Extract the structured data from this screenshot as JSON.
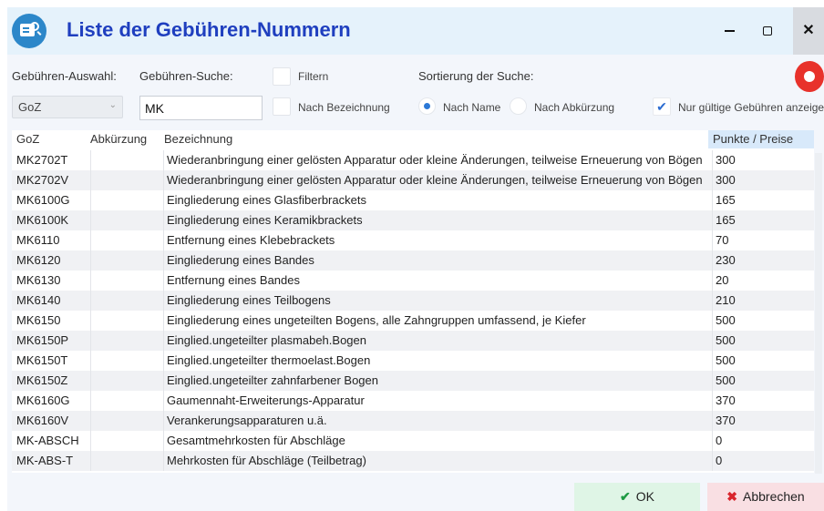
{
  "window": {
    "title": "Liste der Gebühren-Nummern"
  },
  "filters": {
    "selection_label": "Gebühren-Auswahl:",
    "selection_value": "GoZ",
    "search_label": "Gebühren-Suche:",
    "search_value": "MK",
    "filter_label": "Filtern",
    "by_description_label": "Nach Bezeichnung",
    "sort_label": "Sortierung der Suche:",
    "sort_by_name_label": "Nach Name",
    "sort_by_abbrev_label": "Nach Abkürzung",
    "only_valid_label": "Nur gültige Gebühren anzeigen"
  },
  "table": {
    "headers": [
      "GoZ",
      "Abkürzung",
      "Bezeichnung",
      "Punkte / Preise"
    ],
    "rows": [
      {
        "code": "MK2702T",
        "abbr": "",
        "desc": "Wiederanbringung einer gelösten Apparatur oder kleine Änderungen, teilweise Erneuerung von Bögen",
        "price": "300"
      },
      {
        "code": "MK2702V",
        "abbr": "",
        "desc": "Wiederanbringung einer gelösten Apparatur oder kleine Änderungen, teilweise Erneuerung von Bögen",
        "price": "300"
      },
      {
        "code": "MK6100G",
        "abbr": "",
        "desc": "Eingliederung eines Glasfiberbrackets",
        "price": "165"
      },
      {
        "code": "MK6100K",
        "abbr": "",
        "desc": "Eingliederung eines Keramikbrackets",
        "price": "165"
      },
      {
        "code": "MK6110",
        "abbr": "",
        "desc": "Entfernung eines Klebebrackets",
        "price": "70"
      },
      {
        "code": "MK6120",
        "abbr": "",
        "desc": "Eingliederung eines Bandes",
        "price": "230"
      },
      {
        "code": "MK6130",
        "abbr": "",
        "desc": "Entfernung eines Bandes",
        "price": "20"
      },
      {
        "code": "MK6140",
        "abbr": "",
        "desc": "Eingliederung eines Teilbogens",
        "price": "210"
      },
      {
        "code": "MK6150",
        "abbr": "",
        "desc": "Eingliederung eines ungeteilten Bogens, alle Zahngruppen umfassend, je Kiefer",
        "price": "500"
      },
      {
        "code": "MK6150P",
        "abbr": "",
        "desc": "Einglied.ungeteilter plasmabeh.Bogen",
        "price": "500"
      },
      {
        "code": "MK6150T",
        "abbr": "",
        "desc": "Einglied.ungeteilter thermoelast.Bogen",
        "price": "500"
      },
      {
        "code": "MK6150Z",
        "abbr": "",
        "desc": "Einglied.ungeteilter zahnfarbener Bogen",
        "price": "500"
      },
      {
        "code": "MK6160G",
        "abbr": "",
        "desc": "Gaumennaht-Erweiterungs-Apparatur",
        "price": "370"
      },
      {
        "code": "MK6160V",
        "abbr": "",
        "desc": "Verankerungsapparaturen u.ä.",
        "price": "370"
      },
      {
        "code": "MK-ABSCH",
        "abbr": "",
        "desc": "Gesamtmehrkosten für Abschläge",
        "price": "0"
      },
      {
        "code": "MK-ABS-T",
        "abbr": "",
        "desc": "Mehrkosten für Abschläge (Teilbetrag)",
        "price": "0"
      }
    ]
  },
  "buttons": {
    "ok_label": "OK",
    "cancel_label": "Abbrechen"
  },
  "colors": {
    "title": "#1f3fbf",
    "accent": "#2b78d6",
    "ok_bg": "#dff5e6",
    "cancel_bg": "#f9dfe3",
    "record": "#e8322b"
  },
  "icons": [
    "app-search-icon",
    "minimize-icon",
    "maximize-icon",
    "close-icon",
    "record-icon",
    "check-icon",
    "cross-icon"
  ]
}
